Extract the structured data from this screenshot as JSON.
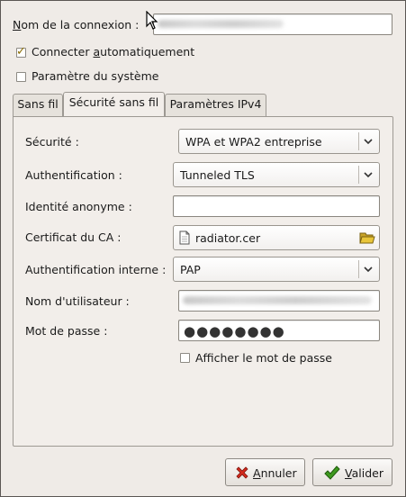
{
  "connection": {
    "name_label_pre": "N",
    "name_label_rest": "om de la connexion :",
    "name_value": "",
    "auto_connect_pre": "Connecter ",
    "auto_connect_ul": "a",
    "auto_connect_post": "utomatiquement",
    "auto_connect_checked": true,
    "system_param_label": "Paramètre du système",
    "system_param_checked": false
  },
  "tabs": [
    {
      "label": "Sans fil",
      "active": false
    },
    {
      "label": "Sécurité sans fil",
      "active": true
    },
    {
      "label": "Paramètres IPv4",
      "active": false
    }
  ],
  "security": {
    "security_label": "Sécurité :",
    "security_value": "WPA et WPA2 entreprise",
    "auth_label": "Authentification :",
    "auth_value": "Tunneled TLS",
    "anon_identity_label": "Identité anonyme :",
    "anon_identity_value": "",
    "ca_cert_label": "Certificat du CA :",
    "ca_cert_value": "radiator.cer",
    "inner_auth_label": "Authentification interne :",
    "inner_auth_value": "PAP",
    "username_label": "Nom d'utilisateur :",
    "password_label": "Mot de passe :",
    "password_mask": "●●●●●●●●",
    "show_password_label": "Afficher le mot de passe",
    "show_password_checked": false
  },
  "buttons": {
    "cancel_ul": "A",
    "cancel_rest": "nnuler",
    "ok_ul": "V",
    "ok_rest": "alider"
  },
  "icons": {
    "cancel": "cancel-red-x-icon",
    "ok": "green-check-icon",
    "document": "document-icon",
    "folder": "folder-icon",
    "cursor": "mouse-pointer-icon"
  },
  "colors": {
    "window_bg": "#efebe7",
    "cancel_icon": "#d42b1e",
    "ok_icon": "#3e9a1f",
    "folder_icon": "#e8c53a"
  }
}
